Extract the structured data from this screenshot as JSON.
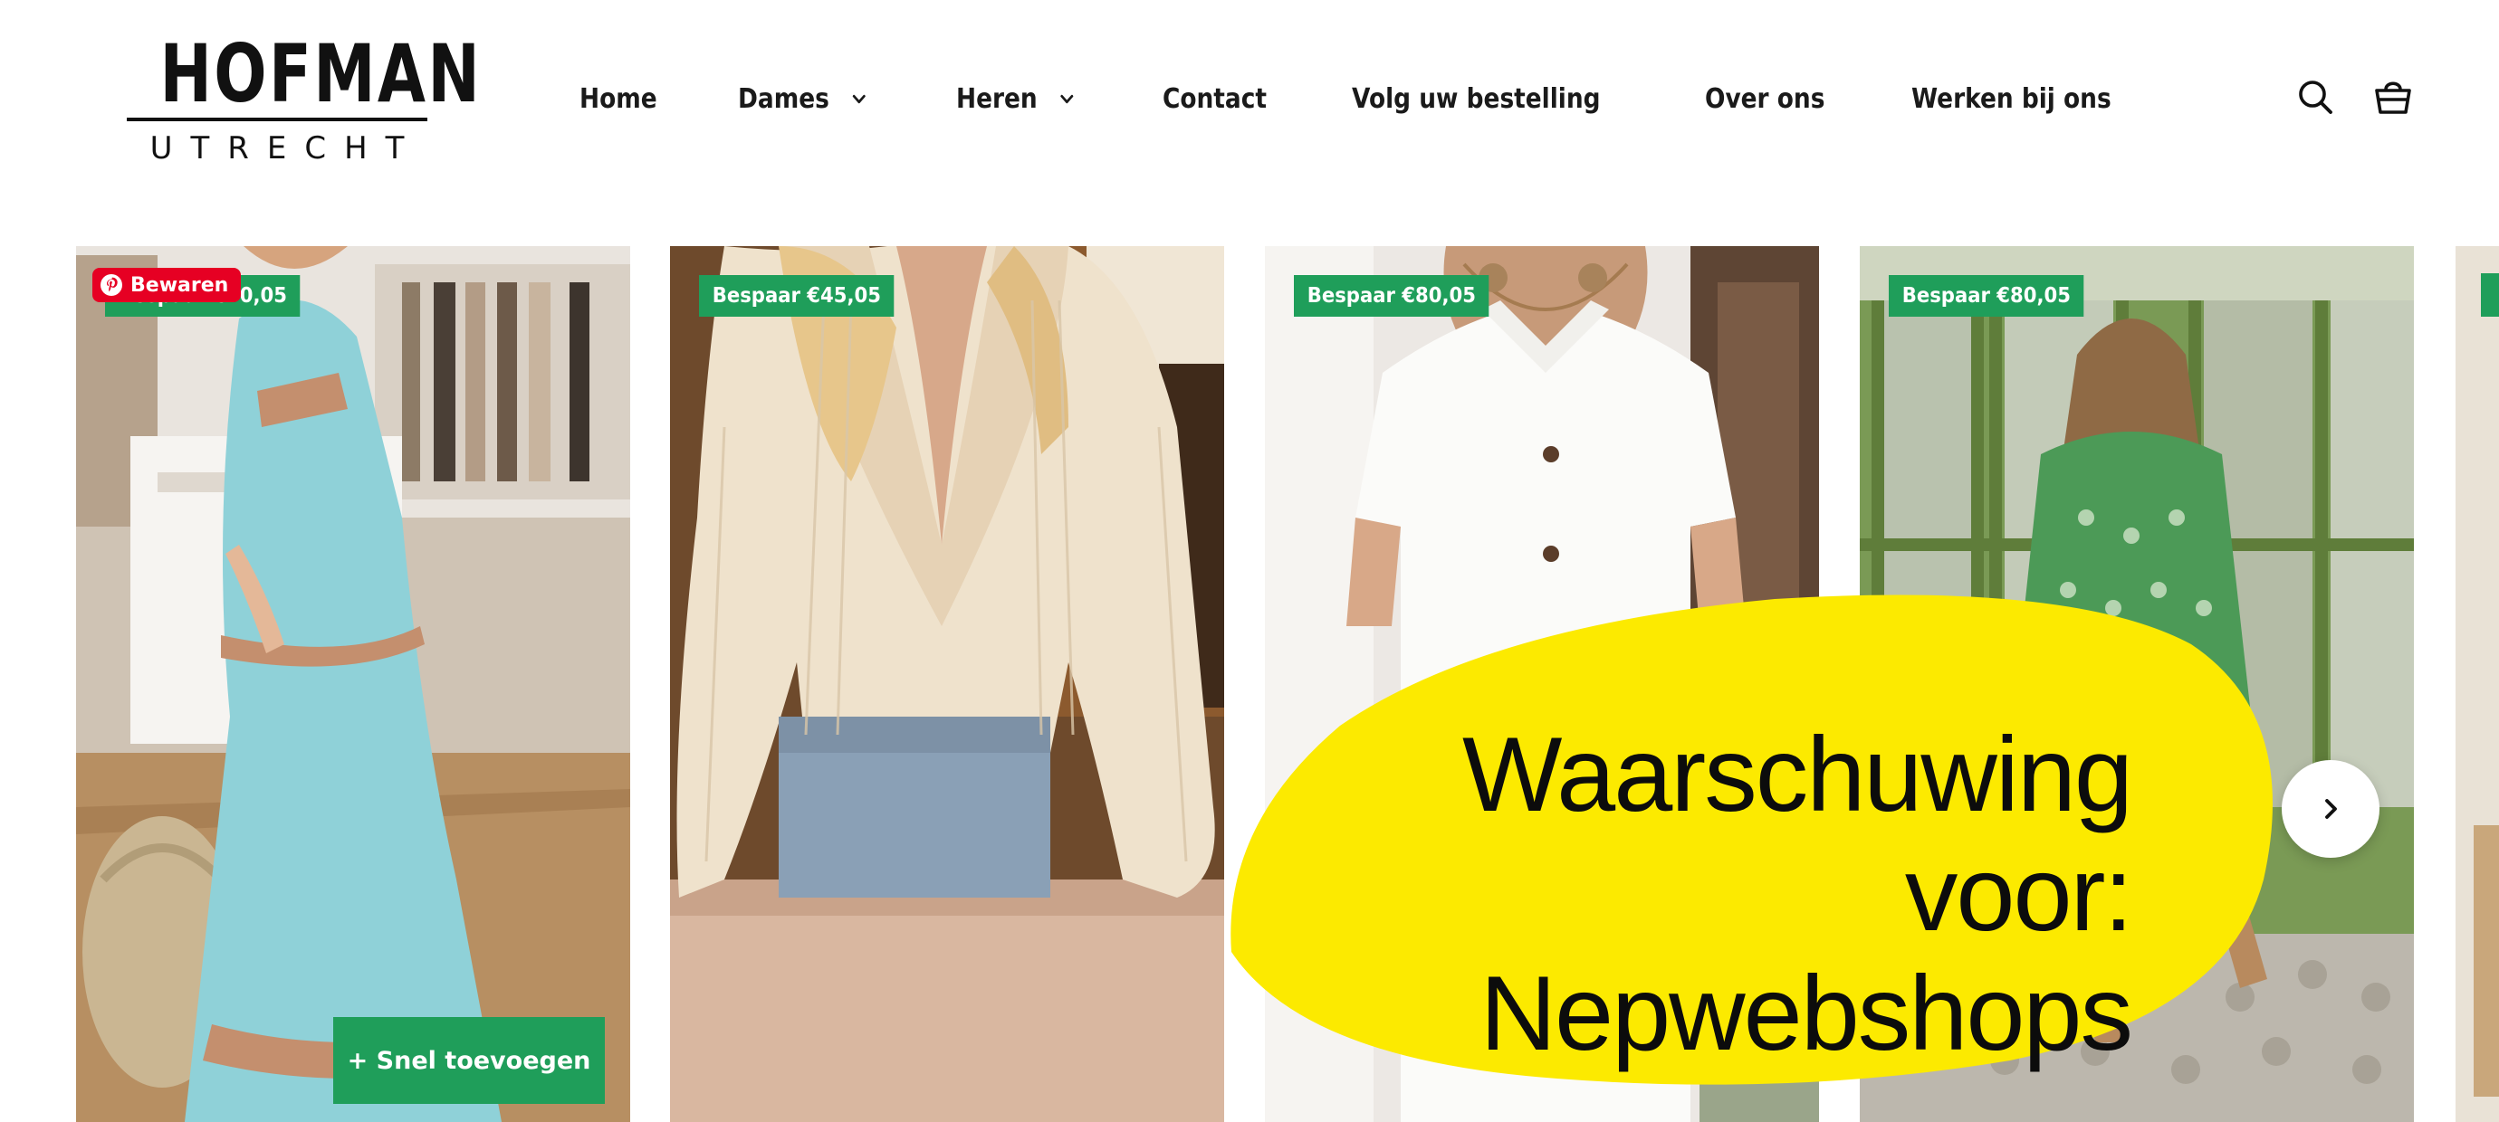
{
  "brand": {
    "name": "HOFMAN",
    "city": "UTRECHT"
  },
  "nav": {
    "items": [
      {
        "label": "Home",
        "has_dropdown": false
      },
      {
        "label": "Dames",
        "has_dropdown": true
      },
      {
        "label": "Heren",
        "has_dropdown": true
      },
      {
        "label": "Contact",
        "has_dropdown": false
      },
      {
        "label": "Volg uw bestelling",
        "has_dropdown": false
      },
      {
        "label": "Over ons",
        "has_dropdown": false
      },
      {
        "label": "Werken bij ons",
        "has_dropdown": false
      }
    ]
  },
  "header_icons": [
    "search-icon",
    "cart-icon"
  ],
  "products": [
    {
      "badge": "Bespaar €70,05",
      "pinterest_label": "Bewaren",
      "quick_add": "+ Snel toevoegen"
    },
    {
      "badge": "Bespaar €45,05"
    },
    {
      "badge": "Bespaar €80,05"
    },
    {
      "badge": "Bespaar €80,05"
    }
  ],
  "overlay": {
    "line1": "Waarschuwing voor:",
    "line2": "Nepwebshops"
  },
  "colors": {
    "badge_green": "#1f9e5a",
    "pinterest_red": "#e60023",
    "warning_yellow": "#fcea00",
    "text_dark": "#111111"
  }
}
